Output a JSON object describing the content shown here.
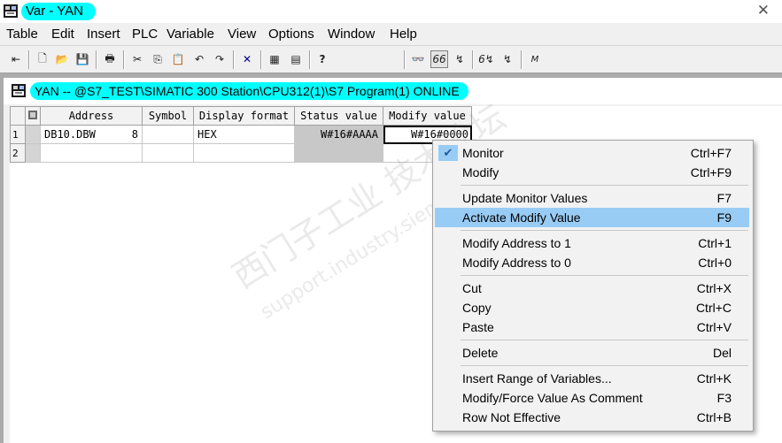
{
  "app": {
    "title": "Var - YAN"
  },
  "menu": [
    "Table",
    "Edit",
    "Insert",
    "PLC",
    "Variable",
    "View",
    "Options",
    "Window",
    "Help"
  ],
  "toolbar": {
    "icons": [
      "pin-icon",
      "new-icon",
      "open-icon",
      "save-icon",
      "print-icon",
      "cut-icon",
      "copy-icon",
      "paste-icon",
      "undo-icon",
      "redo-icon",
      "delete-icon",
      "accessible-nodes-icon",
      "plc-icon",
      "help-pointer-icon",
      "glasses-icon",
      "monitor-icon",
      "modify-icon",
      "monitor-trigger-icon",
      "modify-trigger-icon",
      "force-icon"
    ],
    "glyphs": [
      "⇤",
      "🗋",
      "📂",
      "💾",
      "🖶",
      "✂",
      "⎘",
      "📋",
      "↶",
      "↷",
      "✕",
      "▦",
      "▤",
      "?",
      "👓",
      "66",
      "↯",
      "6↯",
      "↯",
      "M"
    ]
  },
  "child": {
    "title": "YAN -- @S7_TEST\\SIMATIC 300 Station\\CPU312(1)\\S7 Program(1)  ONLINE"
  },
  "table": {
    "headers": [
      "Address",
      "Symbol",
      "Display format",
      "Status value",
      "Modify value"
    ],
    "rows": [
      {
        "num": "1",
        "address": "DB10.DBW",
        "addr_num": "8",
        "symbol": "",
        "format": "HEX",
        "status": "W#16#AAAA",
        "modify": "W#16#0000"
      },
      {
        "num": "2",
        "address": "",
        "addr_num": "",
        "symbol": "",
        "format": "",
        "status": "",
        "modify": ""
      }
    ]
  },
  "context_menu": {
    "items": [
      {
        "label": "Monitor",
        "shortcut": "Ctrl+F7",
        "checked": true
      },
      {
        "label": "Modify",
        "shortcut": "Ctrl+F9"
      },
      {
        "label": "Update Monitor Values",
        "shortcut": "F7"
      },
      {
        "label": "Activate Modify Value",
        "shortcut": "F9",
        "highlighted": true
      },
      {
        "label": "Modify Address to 1",
        "shortcut": "Ctrl+1"
      },
      {
        "label": "Modify Address to 0",
        "shortcut": "Ctrl+0"
      },
      {
        "label": "Cut",
        "shortcut": "Ctrl+X"
      },
      {
        "label": "Copy",
        "shortcut": "Ctrl+C"
      },
      {
        "label": "Paste",
        "shortcut": "Ctrl+V"
      },
      {
        "label": "Delete",
        "shortcut": "Del"
      },
      {
        "label": "Insert Range of Variables...",
        "shortcut": "Ctrl+K"
      },
      {
        "label": "Modify/Force Value As Comment",
        "shortcut": "F3"
      },
      {
        "label": "Row Not Effective",
        "shortcut": "Ctrl+B"
      }
    ],
    "check_glyph": "✔"
  },
  "watermark": {
    "cn": "西门子工业  技术论坛",
    "url": "support.industry.siemens.com/cs"
  },
  "colors": {
    "title_highlight": "#00ffff",
    "menu_highlight": "#99ccf5",
    "status_cell": "#c8c8c8"
  }
}
